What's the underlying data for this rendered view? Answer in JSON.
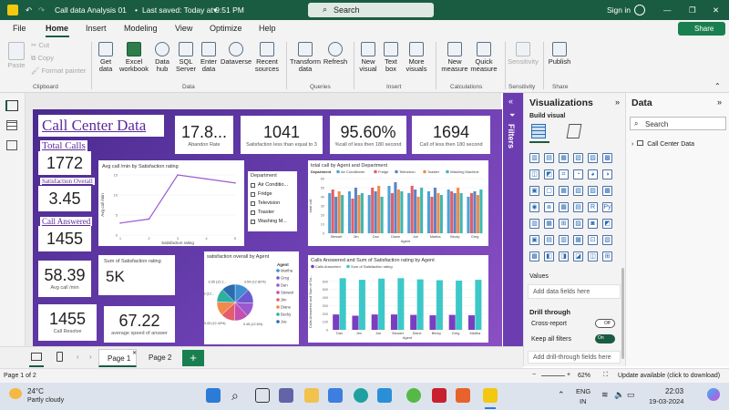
{
  "titlebar": {
    "file_title": "Call data Analysis 01",
    "saved": "Last saved: Today at 9:51 PM",
    "search": "Search",
    "signin": "Sign in"
  },
  "menu": [
    "File",
    "Home",
    "Insert",
    "Modeling",
    "View",
    "Optimize",
    "Help"
  ],
  "share": "Share",
  "ribbon": {
    "paste": "Paste",
    "cut": "Cut",
    "copy": "Copy",
    "format_painter": "Format painter",
    "get_data": "Get data",
    "excel": "Excel workbook",
    "data_hub": "Data hub",
    "sql": "SQL Server",
    "enter_data": "Enter data",
    "dataverse": "Dataverse",
    "recent": "Recent sources",
    "transform": "Transform data",
    "refresh": "Refresh",
    "new_visual": "New visual",
    "text_box": "Text box",
    "more_visuals": "More visuals",
    "new_measure": "New measure",
    "quick_measure": "Quick measure",
    "sensitivity": "Sensitivity",
    "publish": "Publish",
    "groups": [
      "Clipboard",
      "Data",
      "Queries",
      "Insert",
      "Calculations",
      "Sensitivity",
      "Share"
    ]
  },
  "report": {
    "title": "Call Center Data",
    "total_calls_label": "Total Calls",
    "total_calls": "1772",
    "sat_overall_label": "Satisfaction Overall",
    "sat_overall": "3.45",
    "call_answered_label": "Call Answered",
    "call_answered": "1455",
    "kpi_top": [
      {
        "value": "17.8...",
        "label": "Abandon Rate"
      },
      {
        "value": "1041",
        "label": "Satisfaction less than equal to 3"
      },
      {
        "value": "95.60%",
        "label": "%call of less then 180 second"
      },
      {
        "value": "1694",
        "label": "Call of less then 180 second"
      }
    ],
    "avg_call_value": "58.39",
    "avg_call_label": "Avg call /min",
    "sum_sat_label": "Sum of Satisfaction rating",
    "sum_sat_value": "5K",
    "call_resolve_value": "1455",
    "call_resolve_label": "Call Resolve",
    "avg_speed_value": "67.22",
    "avg_speed_label": "average speed of answer",
    "dept_slicer": {
      "title": "Department",
      "items": [
        "Air Conditio...",
        "Fridge",
        "Television",
        "Toaster",
        "Washing M..."
      ]
    },
    "pie_agents": {
      "title": "Agent",
      "items": [
        "Martha",
        "Greg",
        "Dan",
        "Stewart",
        "Jim",
        "Diane",
        "Becky",
        "Joe"
      ]
    }
  },
  "chart_data": [
    {
      "type": "line",
      "title": "Avg call /min by Satisfaction rating",
      "xlabel": "Satisfaction rating",
      "ylabel": "Avg call /min",
      "x": [
        1,
        2,
        3,
        4,
        5
      ],
      "values": [
        3,
        4,
        15,
        14,
        13
      ],
      "ylim": [
        0,
        15
      ],
      "yticks": [
        0,
        5,
        10,
        15
      ],
      "color": "#9b59d0"
    },
    {
      "type": "bar",
      "title": "total call by Agent and Department",
      "xlabel": "Agent",
      "ylabel": "total call",
      "legend_title": "Department",
      "categories": [
        "Stewart",
        "Jim",
        "Dan",
        "Diane",
        "Joe",
        "Martha",
        "Becky",
        "Greg"
      ],
      "ylim": [
        0,
        60
      ],
      "yticks": [
        0,
        10,
        20,
        30,
        40,
        50,
        60
      ],
      "series": [
        {
          "name": "Air Conditioner",
          "color": "#4aa3d8",
          "values": [
            44,
            46,
            42,
            52,
            44,
            46,
            48,
            40
          ]
        },
        {
          "name": "Fridge",
          "color": "#e35d6a",
          "values": [
            48,
            38,
            50,
            44,
            52,
            40,
            46,
            44
          ]
        },
        {
          "name": "Television",
          "color": "#5b84c4",
          "values": [
            40,
            50,
            46,
            56,
            48,
            50,
            44,
            46
          ]
        },
        {
          "name": "Toaster",
          "color": "#f08a4b",
          "values": [
            46,
            42,
            52,
            48,
            40,
            44,
            50,
            42
          ]
        },
        {
          "name": "Washing Machine",
          "color": "#3cb8b0",
          "values": [
            42,
            44,
            40,
            46,
            50,
            42,
            44,
            48
          ]
        }
      ]
    },
    {
      "type": "pie",
      "title": "satisfaction overall by Agent",
      "series": [
        {
          "name": "Martha",
          "color": "#3e8ed0",
          "value": 3.54,
          "label": "3.54 (12.82%)"
        },
        {
          "name": "Greg",
          "color": "#6b5bd0",
          "value": 3.49
        },
        {
          "name": "Dan",
          "color": "#9b59d0",
          "value": 3.45
        },
        {
          "name": "Stewart",
          "color": "#c34fb0",
          "value": 3.45,
          "label": "3.45 (12.6%)"
        },
        {
          "name": "Jim",
          "color": "#e35d6a",
          "value": 3.43,
          "label": "3.43 (12.42%)"
        },
        {
          "name": "Diane",
          "color": "#f08a4b",
          "value": 3.42
        },
        {
          "name": "Becky",
          "color": "#2db0a0",
          "value": 3.39,
          "label": "3.39 (12..."
        },
        {
          "name": "Joe",
          "color": "#2b6cb0",
          "value": 3.35,
          "label": "3.35 (12.1..."
        }
      ]
    },
    {
      "type": "bar",
      "title": "Calls Answered and Sum of Satisfaction rating by Agent",
      "xlabel": "Agent",
      "ylabel": "Calls Answered and Sum of Sa...",
      "categories": [
        "Dan",
        "Jim",
        "Joe",
        "Stewart",
        "Diane",
        "Becky",
        "Greg",
        "Martha"
      ],
      "ylim": [
        0,
        700
      ],
      "yticks": [
        0,
        100,
        200,
        300,
        400,
        500,
        600
      ],
      "series": [
        {
          "name": "Calls Answered",
          "color": "#7a3ec0",
          "values": [
            190,
            175,
            190,
            190,
            185,
            180,
            185,
            180
          ]
        },
        {
          "name": "Sum of Satisfaction rating",
          "color": "#3cc8c8",
          "values": [
            640,
            620,
            635,
            640,
            625,
            615,
            610,
            620
          ]
        }
      ]
    }
  ],
  "filters_label": "Filters",
  "viz": {
    "title": "Visualizations",
    "build": "Build visual",
    "values": "Values",
    "add_fields": "Add data fields here",
    "drill": "Drill through",
    "cross": "Cross-report",
    "cross_state": "Off",
    "keep": "Keep all filters",
    "keep_state": "On",
    "add_drill": "Add drill-through fields here"
  },
  "datapane": {
    "title": "Data",
    "search": "Search",
    "table": "Call Center Data"
  },
  "tabs": {
    "page1": "Page 1",
    "page2": "Page 2",
    "add": "+"
  },
  "status": {
    "page": "Page 1 of 2",
    "zoom": "62%",
    "update": "Update available (click to download)"
  },
  "taskbar": {
    "temp": "24°C",
    "weather": "Partly cloudy",
    "lang1": "ENG",
    "lang2": "IN",
    "time": "22:03",
    "date": "19-03-2024"
  }
}
